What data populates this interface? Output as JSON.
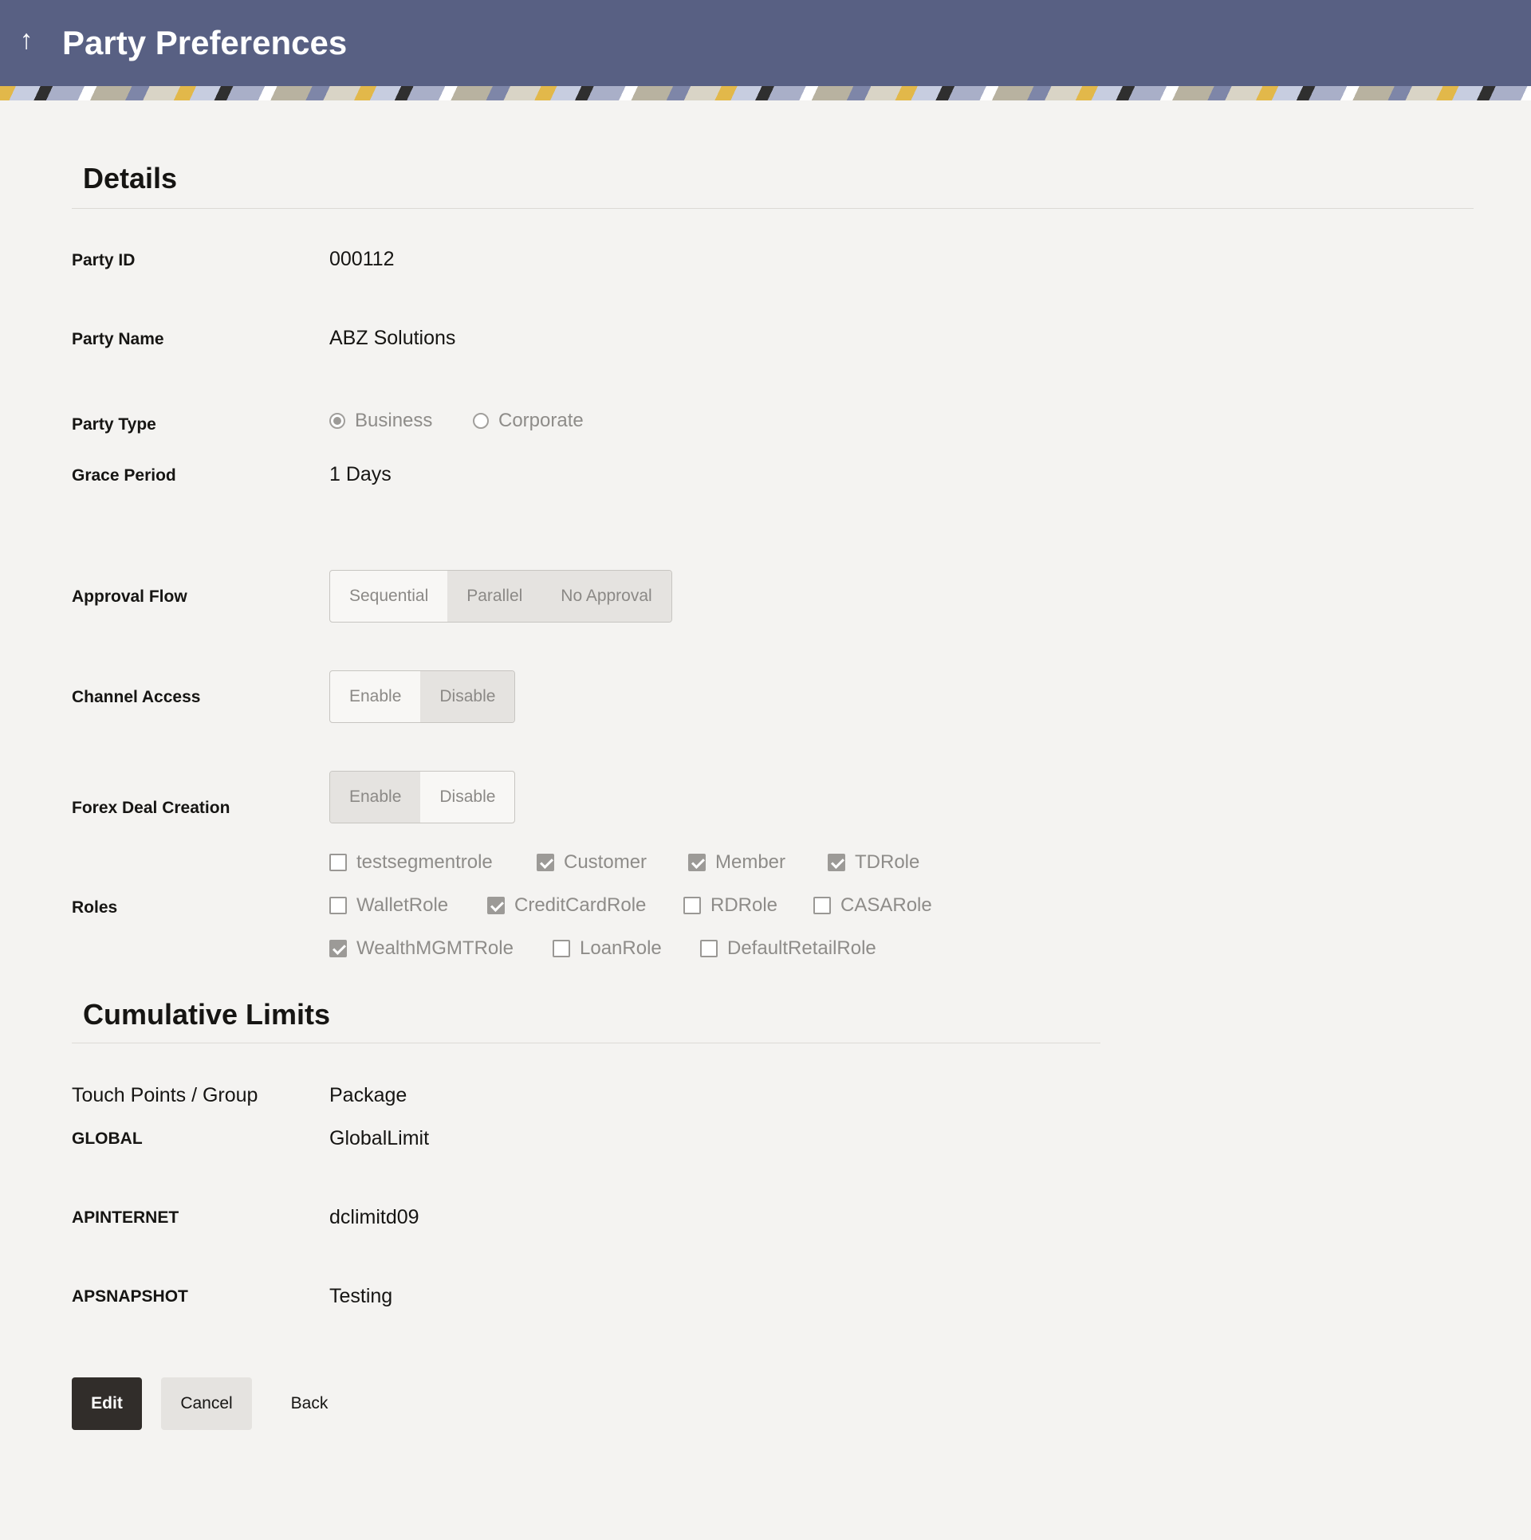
{
  "header": {
    "title": "Party Preferences"
  },
  "details": {
    "section_title": "Details",
    "party_id": {
      "label": "Party ID",
      "value": "000112"
    },
    "party_name": {
      "label": "Party Name",
      "value": "ABZ Solutions"
    },
    "party_type": {
      "label": "Party Type",
      "options": [
        "Business",
        "Corporate"
      ],
      "selected": "Business"
    },
    "grace_period": {
      "label": "Grace Period",
      "value": "1 Days"
    },
    "approval_flow": {
      "label": "Approval Flow",
      "options": [
        "Sequential",
        "Parallel",
        "No Approval"
      ],
      "selected": [
        "Parallel",
        "No Approval"
      ]
    },
    "channel_access": {
      "label": "Channel Access",
      "options": [
        "Enable",
        "Disable"
      ],
      "selected": "Disable"
    },
    "forex_deal_creation": {
      "label": "Forex Deal Creation",
      "options": [
        "Enable",
        "Disable"
      ],
      "selected": "Enable"
    },
    "roles": {
      "label": "Roles",
      "items": [
        {
          "name": "testsegmentrole",
          "checked": false
        },
        {
          "name": "Customer",
          "checked": true
        },
        {
          "name": "Member",
          "checked": true
        },
        {
          "name": "TDRole",
          "checked": true
        },
        {
          "name": "WalletRole",
          "checked": false
        },
        {
          "name": "CreditCardRole",
          "checked": true
        },
        {
          "name": "RDRole",
          "checked": false
        },
        {
          "name": "CASARole",
          "checked": false
        },
        {
          "name": "WealthMGMTRole",
          "checked": true
        },
        {
          "name": "LoanRole",
          "checked": false
        },
        {
          "name": "DefaultRetailRole",
          "checked": false
        }
      ]
    }
  },
  "cumulative_limits": {
    "section_title": "Cumulative Limits",
    "column_headers": [
      "Touch Points / Group",
      "Package"
    ],
    "rows": [
      {
        "touch_point": "GLOBAL",
        "package": "GlobalLimit"
      },
      {
        "touch_point": "APINTERNET",
        "package": "dclimitd09"
      },
      {
        "touch_point": "APSNAPSHOT",
        "package": "Testing"
      }
    ]
  },
  "actions": {
    "edit": "Edit",
    "cancel": "Cancel",
    "back": "Back"
  },
  "icons": {
    "back": "arrow-up-icon"
  },
  "colors": {
    "header_bg": "#586083",
    "primary_button": "#312d2a",
    "page_bg": "#f4f3f1"
  }
}
